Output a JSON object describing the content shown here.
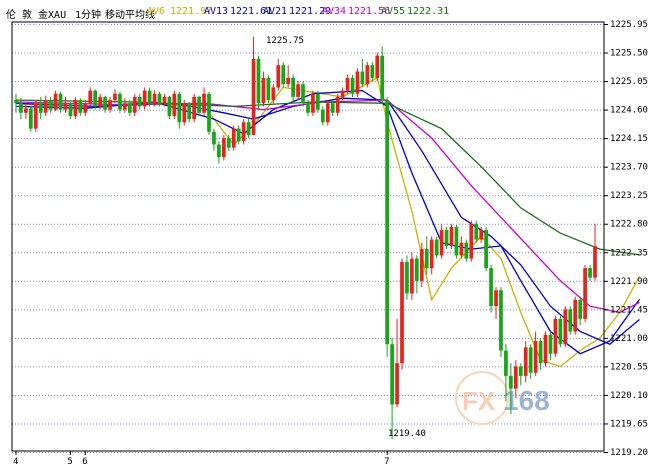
{
  "header": {
    "instrument": "伦 敦 金XAU",
    "period": "1分钟",
    "indicator": "移动平均线",
    "ma_legend": [
      {
        "label": "AV6",
        "value": "1221.97",
        "color": "#c8b400"
      },
      {
        "label": "AV13",
        "value": "1221.61",
        "color": "#0000cc"
      },
      {
        "label": "AV21",
        "value": "1221.29",
        "color": "#0000cc"
      },
      {
        "label": "AV34",
        "value": "1221.56",
        "color": "#cc00cc"
      },
      {
        "label": "AV55",
        "value": "1222.31",
        "color": "#1a6e1a"
      }
    ]
  },
  "annotations": {
    "high": "1225.75",
    "low": "1219.40"
  },
  "watermark": {
    "prefix": "FX",
    "suffix": "168"
  },
  "colors": {
    "up": "#e8231e",
    "down": "#16a616",
    "grid": "#7c8cc8",
    "frame": "#000000"
  },
  "chart_data": {
    "type": "candlestick",
    "y_ticks": [
      "1225.95",
      "1225.50",
      "1225.05",
      "1224.60",
      "1224.15",
      "1223.70",
      "1223.25",
      "1222.80",
      "1222.35",
      "1221.90",
      "1221.45",
      "1221.00",
      "1220.55",
      "1220.10",
      "1219.65",
      "1219.20"
    ],
    "ylim": [
      1219.2,
      1225.95
    ],
    "x_labels": [
      {
        "text": "4",
        "index": 0
      },
      {
        "text": "5",
        "index": 11
      },
      {
        "text": "6",
        "index": 14
      },
      {
        "text": "7",
        "index": 75
      }
    ],
    "candles": [
      [
        1224.75,
        1224.7,
        1224.85,
        1224.55
      ],
      [
        1224.7,
        1224.55,
        1224.78,
        1224.45
      ],
      [
        1224.55,
        1224.62,
        1224.7,
        1224.45
      ],
      [
        1224.62,
        1224.3,
        1224.65,
        1224.25
      ],
      [
        1224.3,
        1224.7,
        1224.75,
        1224.25
      ],
      [
        1224.7,
        1224.55,
        1224.8,
        1224.45
      ],
      [
        1224.55,
        1224.75,
        1224.82,
        1224.5
      ],
      [
        1224.75,
        1224.6,
        1224.8,
        1224.55
      ],
      [
        1224.6,
        1224.85,
        1224.9,
        1224.58
      ],
      [
        1224.85,
        1224.6,
        1224.88,
        1224.55
      ],
      [
        1224.6,
        1224.7,
        1224.8,
        1224.55
      ],
      [
        1224.7,
        1224.5,
        1224.72,
        1224.45
      ],
      [
        1224.5,
        1224.75,
        1224.8,
        1224.45
      ],
      [
        1224.75,
        1224.55,
        1224.78,
        1224.5
      ],
      [
        1224.55,
        1224.7,
        1224.75,
        1224.5
      ],
      [
        1224.7,
        1224.9,
        1224.95,
        1224.65
      ],
      [
        1224.9,
        1224.65,
        1224.92,
        1224.6
      ],
      [
        1224.65,
        1224.8,
        1224.85,
        1224.6
      ],
      [
        1224.8,
        1224.6,
        1224.82,
        1224.55
      ],
      [
        1224.6,
        1224.75,
        1224.8,
        1224.55
      ],
      [
        1224.75,
        1224.85,
        1224.92,
        1224.7
      ],
      [
        1224.85,
        1224.6,
        1224.88,
        1224.55
      ],
      [
        1224.6,
        1224.7,
        1224.78,
        1224.55
      ],
      [
        1224.7,
        1224.55,
        1224.75,
        1224.5
      ],
      [
        1224.55,
        1224.8,
        1224.85,
        1224.5
      ],
      [
        1224.8,
        1224.65,
        1224.85,
        1224.6
      ],
      [
        1224.65,
        1224.9,
        1224.95,
        1224.6
      ],
      [
        1224.9,
        1224.7,
        1224.95,
        1224.65
      ],
      [
        1224.7,
        1224.85,
        1224.9,
        1224.65
      ],
      [
        1224.85,
        1224.7,
        1224.88,
        1224.65
      ],
      [
        1224.7,
        1224.8,
        1224.85,
        1224.65
      ],
      [
        1224.8,
        1224.5,
        1224.82,
        1224.45
      ],
      [
        1224.5,
        1224.85,
        1224.9,
        1224.45
      ],
      [
        1224.85,
        1224.4,
        1224.88,
        1224.3
      ],
      [
        1224.4,
        1224.7,
        1224.75,
        1224.35
      ],
      [
        1224.7,
        1224.45,
        1224.72,
        1224.4
      ],
      [
        1224.45,
        1224.8,
        1224.85,
        1224.4
      ],
      [
        1224.8,
        1224.55,
        1224.82,
        1224.5
      ],
      [
        1224.55,
        1224.85,
        1224.95,
        1224.5
      ],
      [
        1224.85,
        1224.25,
        1224.88,
        1224.2
      ],
      [
        1224.25,
        1224.05,
        1224.3,
        1223.95
      ],
      [
        1224.05,
        1223.85,
        1224.1,
        1223.75
      ],
      [
        1223.85,
        1224.15,
        1224.2,
        1223.8
      ],
      [
        1224.15,
        1224.0,
        1224.2,
        1223.95
      ],
      [
        1224.0,
        1224.3,
        1224.35,
        1223.95
      ],
      [
        1224.3,
        1224.1,
        1224.35,
        1224.05
      ],
      [
        1224.1,
        1224.4,
        1224.45,
        1224.05
      ],
      [
        1224.4,
        1224.2,
        1224.45,
        1224.15
      ],
      [
        1224.2,
        1225.4,
        1225.75,
        1224.2
      ],
      [
        1225.4,
        1224.7,
        1225.45,
        1224.6
      ],
      [
        1224.7,
        1225.1,
        1225.2,
        1224.65
      ],
      [
        1225.1,
        1224.75,
        1225.15,
        1224.7
      ],
      [
        1224.75,
        1224.95,
        1225.0,
        1224.7
      ],
      [
        1224.95,
        1225.3,
        1225.4,
        1224.9
      ],
      [
        1225.3,
        1225.0,
        1225.35,
        1224.95
      ],
      [
        1225.0,
        1225.1,
        1225.3,
        1224.95
      ],
      [
        1225.1,
        1224.8,
        1225.15,
        1224.7
      ],
      [
        1224.8,
        1225.0,
        1225.05,
        1224.75
      ],
      [
        1225.0,
        1224.7,
        1225.05,
        1224.65
      ],
      [
        1224.7,
        1224.55,
        1224.75,
        1224.5
      ],
      [
        1224.55,
        1224.85,
        1224.9,
        1224.5
      ],
      [
        1224.85,
        1224.6,
        1224.9,
        1224.55
      ],
      [
        1224.6,
        1224.4,
        1224.65,
        1224.35
      ],
      [
        1224.4,
        1224.7,
        1224.75,
        1224.35
      ],
      [
        1224.7,
        1224.55,
        1224.75,
        1224.5
      ],
      [
        1224.55,
        1224.8,
        1224.85,
        1224.5
      ],
      [
        1224.8,
        1224.9,
        1224.95,
        1224.75
      ],
      [
        1224.9,
        1225.1,
        1225.15,
        1224.85
      ],
      [
        1225.1,
        1224.85,
        1225.15,
        1224.8
      ],
      [
        1224.85,
        1225.2,
        1225.25,
        1224.8
      ],
      [
        1225.2,
        1225.0,
        1225.4,
        1224.95
      ],
      [
        1225.0,
        1225.3,
        1225.35,
        1224.95
      ],
      [
        1225.3,
        1225.1,
        1225.35,
        1225.05
      ],
      [
        1225.1,
        1225.45,
        1225.5,
        1225.05
      ],
      [
        1225.45,
        1224.75,
        1225.6,
        1224.7
      ],
      [
        1224.75,
        1220.9,
        1224.8,
        1220.7
      ],
      [
        1220.9,
        1219.95,
        1221.0,
        1219.4
      ],
      [
        1219.95,
        1220.6,
        1221.3,
        1219.9
      ],
      [
        1220.6,
        1222.2,
        1222.25,
        1220.5
      ],
      [
        1222.2,
        1221.7,
        1222.3,
        1221.6
      ],
      [
        1221.7,
        1222.25,
        1222.35,
        1221.6
      ],
      [
        1222.25,
        1221.9,
        1222.3,
        1221.7
      ],
      [
        1221.9,
        1222.4,
        1222.5,
        1221.8
      ],
      [
        1222.4,
        1222.1,
        1222.6,
        1222.0
      ],
      [
        1222.1,
        1222.55,
        1222.6,
        1222.0
      ],
      [
        1222.55,
        1222.3,
        1222.6,
        1222.25
      ],
      [
        1222.3,
        1222.7,
        1222.8,
        1222.25
      ],
      [
        1222.7,
        1222.45,
        1222.75,
        1222.4
      ],
      [
        1222.45,
        1222.75,
        1222.8,
        1222.4
      ],
      [
        1222.75,
        1222.3,
        1222.78,
        1222.25
      ],
      [
        1222.3,
        1222.5,
        1222.6,
        1222.25
      ],
      [
        1222.5,
        1222.25,
        1222.55,
        1222.2
      ],
      [
        1222.25,
        1222.8,
        1222.85,
        1222.2
      ],
      [
        1222.8,
        1222.55,
        1222.85,
        1222.5
      ],
      [
        1222.55,
        1222.7,
        1222.75,
        1222.5
      ],
      [
        1222.7,
        1222.1,
        1222.75,
        1222.05
      ],
      [
        1222.1,
        1221.5,
        1222.15,
        1221.4
      ],
      [
        1221.5,
        1221.75,
        1221.8,
        1221.3
      ],
      [
        1221.75,
        1220.8,
        1221.8,
        1220.7
      ],
      [
        1220.8,
        1220.4,
        1220.9,
        1220.0
      ],
      [
        1220.4,
        1220.2,
        1220.6,
        1219.8
      ],
      [
        1220.2,
        1220.55,
        1220.65,
        1220.05
      ],
      [
        1220.55,
        1220.4,
        1220.6,
        1220.25
      ],
      [
        1220.4,
        1220.85,
        1220.95,
        1220.3
      ],
      [
        1220.85,
        1220.45,
        1220.9,
        1220.35
      ],
      [
        1220.45,
        1220.95,
        1221.1,
        1220.4
      ],
      [
        1220.95,
        1220.6,
        1221.0,
        1220.5
      ],
      [
        1220.6,
        1221.05,
        1221.1,
        1220.55
      ],
      [
        1221.05,
        1220.75,
        1221.1,
        1220.65
      ],
      [
        1220.75,
        1221.3,
        1221.35,
        1220.7
      ],
      [
        1221.3,
        1220.9,
        1221.35,
        1220.85
      ],
      [
        1220.9,
        1221.45,
        1221.5,
        1220.85
      ],
      [
        1221.45,
        1221.1,
        1221.5,
        1221.05
      ],
      [
        1221.1,
        1221.6,
        1221.65,
        1221.05
      ],
      [
        1221.6,
        1221.3,
        1221.65,
        1221.2
      ],
      [
        1221.3,
        1222.1,
        1222.15,
        1221.25
      ],
      [
        1222.1,
        1221.95,
        1222.15,
        1221.9
      ],
      [
        1221.95,
        1222.45,
        1222.8,
        1221.9
      ]
    ],
    "ma": {
      "AV6": [
        [
          0,
          1224.7
        ],
        [
          12,
          1224.62
        ],
        [
          24,
          1224.7
        ],
        [
          38,
          1224.65
        ],
        [
          44,
          1224.05
        ],
        [
          48,
          1224.35
        ],
        [
          54,
          1224.95
        ],
        [
          66,
          1224.8
        ],
        [
          73,
          1225.1
        ],
        [
          75,
          1224.4
        ],
        [
          80,
          1223.0
        ],
        [
          84,
          1221.6
        ],
        [
          88,
          1222.1
        ],
        [
          94,
          1222.6
        ],
        [
          98,
          1222.25
        ],
        [
          102,
          1221.4
        ],
        [
          106,
          1220.65
        ],
        [
          110,
          1220.55
        ],
        [
          114,
          1220.8
        ],
        [
          118,
          1221.0
        ],
        [
          122,
          1221.4
        ],
        [
          126,
          1221.97
        ]
      ],
      "AV13": [
        [
          0,
          1224.65
        ],
        [
          14,
          1224.62
        ],
        [
          28,
          1224.72
        ],
        [
          40,
          1224.45
        ],
        [
          46,
          1224.22
        ],
        [
          52,
          1224.6
        ],
        [
          60,
          1224.85
        ],
        [
          70,
          1224.9
        ],
        [
          75,
          1224.65
        ],
        [
          80,
          1223.6
        ],
        [
          86,
          1222.5
        ],
        [
          92,
          1222.4
        ],
        [
          98,
          1222.45
        ],
        [
          102,
          1221.9
        ],
        [
          108,
          1221.1
        ],
        [
          114,
          1220.75
        ],
        [
          120,
          1220.95
        ],
        [
          126,
          1221.61
        ]
      ],
      "AV21": [
        [
          0,
          1224.7
        ],
        [
          16,
          1224.65
        ],
        [
          32,
          1224.7
        ],
        [
          42,
          1224.55
        ],
        [
          48,
          1224.45
        ],
        [
          56,
          1224.65
        ],
        [
          66,
          1224.78
        ],
        [
          75,
          1224.75
        ],
        [
          82,
          1223.95
        ],
        [
          90,
          1222.9
        ],
        [
          96,
          1222.6
        ],
        [
          102,
          1222.15
        ],
        [
          108,
          1221.5
        ],
        [
          114,
          1221.1
        ],
        [
          120,
          1220.9
        ],
        [
          126,
          1221.29
        ]
      ],
      "AV34": [
        [
          0,
          1224.72
        ],
        [
          20,
          1224.68
        ],
        [
          38,
          1224.7
        ],
        [
          50,
          1224.6
        ],
        [
          62,
          1224.72
        ],
        [
          75,
          1224.75
        ],
        [
          84,
          1224.15
        ],
        [
          92,
          1223.4
        ],
        [
          98,
          1222.9
        ],
        [
          104,
          1222.4
        ],
        [
          110,
          1221.9
        ],
        [
          116,
          1221.5
        ],
        [
          122,
          1221.4
        ],
        [
          126,
          1221.56
        ]
      ],
      "AV55": [
        [
          0,
          1224.75
        ],
        [
          24,
          1224.72
        ],
        [
          44,
          1224.65
        ],
        [
          60,
          1224.72
        ],
        [
          75,
          1224.7
        ],
        [
          86,
          1224.3
        ],
        [
          94,
          1223.7
        ],
        [
          102,
          1223.05
        ],
        [
          110,
          1222.65
        ],
        [
          118,
          1222.4
        ],
        [
          126,
          1222.31
        ]
      ]
    }
  }
}
